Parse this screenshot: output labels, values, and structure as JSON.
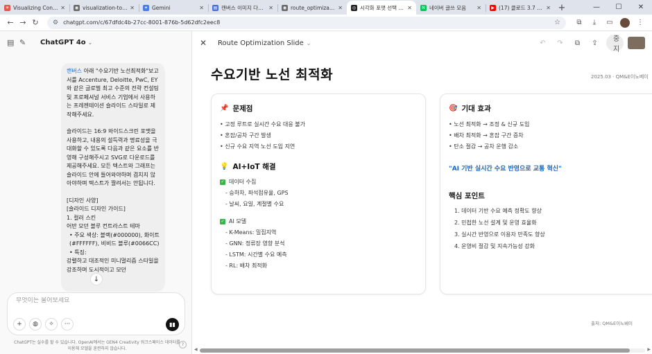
{
  "browser": {
    "tabs": [
      {
        "title": "Visualizing Consulting",
        "fav_color": "#e8554e",
        "fav_glyph": "✳"
      },
      {
        "title": "visualization-tools-sl",
        "fav_color": "#6b6b6b",
        "fav_glyph": "◉"
      },
      {
        "title": "Gemini",
        "fav_color": "#4a7cf0",
        "fav_glyph": "✦"
      },
      {
        "title": "캔버스 이미지 다운로",
        "fav_color": "#4a6ee0",
        "fav_glyph": "▤"
      },
      {
        "title": "route_optimization_p",
        "fav_color": "#6b6b6b",
        "fav_glyph": "◉"
      },
      {
        "title": "시각화 포맷 선택 가이",
        "fav_color": "#222222",
        "fav_glyph": "◎"
      },
      {
        "title": "네이버 글쓰 모음",
        "fav_color": "#03c75a",
        "fav_glyph": "N"
      },
      {
        "title": "(17) 클로드 3.7 Sonn",
        "fav_color": "#ff0000",
        "fav_glyph": "▶"
      }
    ],
    "active_tab": 5,
    "new_tab": "+",
    "win_min": "—",
    "win_max": "☐",
    "win_close": "✕",
    "url": "chatgpt.com/c/67dfdc4b-27cc-8001-876b-5d62dfc2eec8"
  },
  "chat": {
    "model_name": "ChatGPT 4o",
    "model_caret": "⌄",
    "message_canvas_word": "캔버스",
    "message_intro": " 아래 \"수요기반 노선최적화\"보고서를 Accenture, Deloitte, PwC, EY와 같은 글로벌 최고 수준의 전략 컨설팅 및 프로페셔널 서비스 기업에서 사용하는 프레젠테이션 슬라이드 스타일로 제작해주세요.",
    "message_body": "슬라이드는 16:9 와이드스크린 포맷을 사용하고, 내용의 설득력과 명료성을 극대화할 수 있도록 다음과 같은 요소를 반영해 구성해주시고 SVG로 다운로드를 제공해주세요. 모든 텍스트와 그래프는 슬라이드 안에 들어와야하며 겹치지 않아야하며 텍스트가 짤려서는 안됩니다.",
    "lines": [
      "[디자인 사양]",
      "[슬라이드 디자인 가이드]",
      "1. 컬러 스킨",
      "어반 모던 블루 컨트라스트 테마",
      "•  주요 색상: 블랙(#000000), 화이트(#FFFFFF), 비비드 블루(#0066CC)",
      "•  특징:",
      "강렬하고 대조적인 미니멀리즘 스타일을 강조하며 도시적이고 모던"
    ],
    "composer_placeholder": "무엇이든 물어보세요",
    "disclaimer": "ChatGPT는 실수를 할 수 있습니다. OpenAI에서는 GEN4 Creativity 워크스페이스 데이터를 이용해 모델을 훈련하지 않습니다."
  },
  "canvas": {
    "title": "Route Optimization Slide",
    "caret": "⌄",
    "stop_label": "중지",
    "slide": {
      "title": "수요기반 노선 최적화",
      "date": "2025.03 · QM&E이노베이",
      "problem_heading": "문제점",
      "problems": [
        "• 고정 루트로 실시간 수요 대응 불가",
        "• 혼잡/공차 구간 발생",
        "• 신규 수요 지역 노선 도입 지연"
      ],
      "solution_heading": "AI+IoT 해결",
      "data_heading": "데이터 수집",
      "data_items": [
        "- 승하차, 좌석점유율, GPS",
        "- 날씨, 요일, 계절별 수요"
      ],
      "model_heading": "AI 모델",
      "model_items": [
        "- K-Means: 밀집지역",
        "- GNN: 정류장 영향 분석",
        "- LSTM: 시간별 수요 예측",
        "- RL: 배차 최적화"
      ],
      "effect_heading": "기대 효과",
      "effects": [
        "• 노선 최적화 → 조정 & 신규 도입",
        "• 배차 최적화 → 혼잡 구간 증차",
        "• 탄소 절감 → 공차 운행 감소"
      ],
      "quote": "\"AI 기반 실시간 수요 반영으로 교통 혁신\"",
      "key_heading": "핵심 포인트",
      "key_points": [
        "1. 데이터 기반 수요 예측 정확도 향상",
        "2. 민첩한 노선 설계 및 운영 효율화",
        "3. 실시간 반영으로 이용자 만족도 향상",
        "4. 운영비 절감 및 지속가능성 강화"
      ],
      "source": "출처: QM&E이노베이"
    }
  }
}
